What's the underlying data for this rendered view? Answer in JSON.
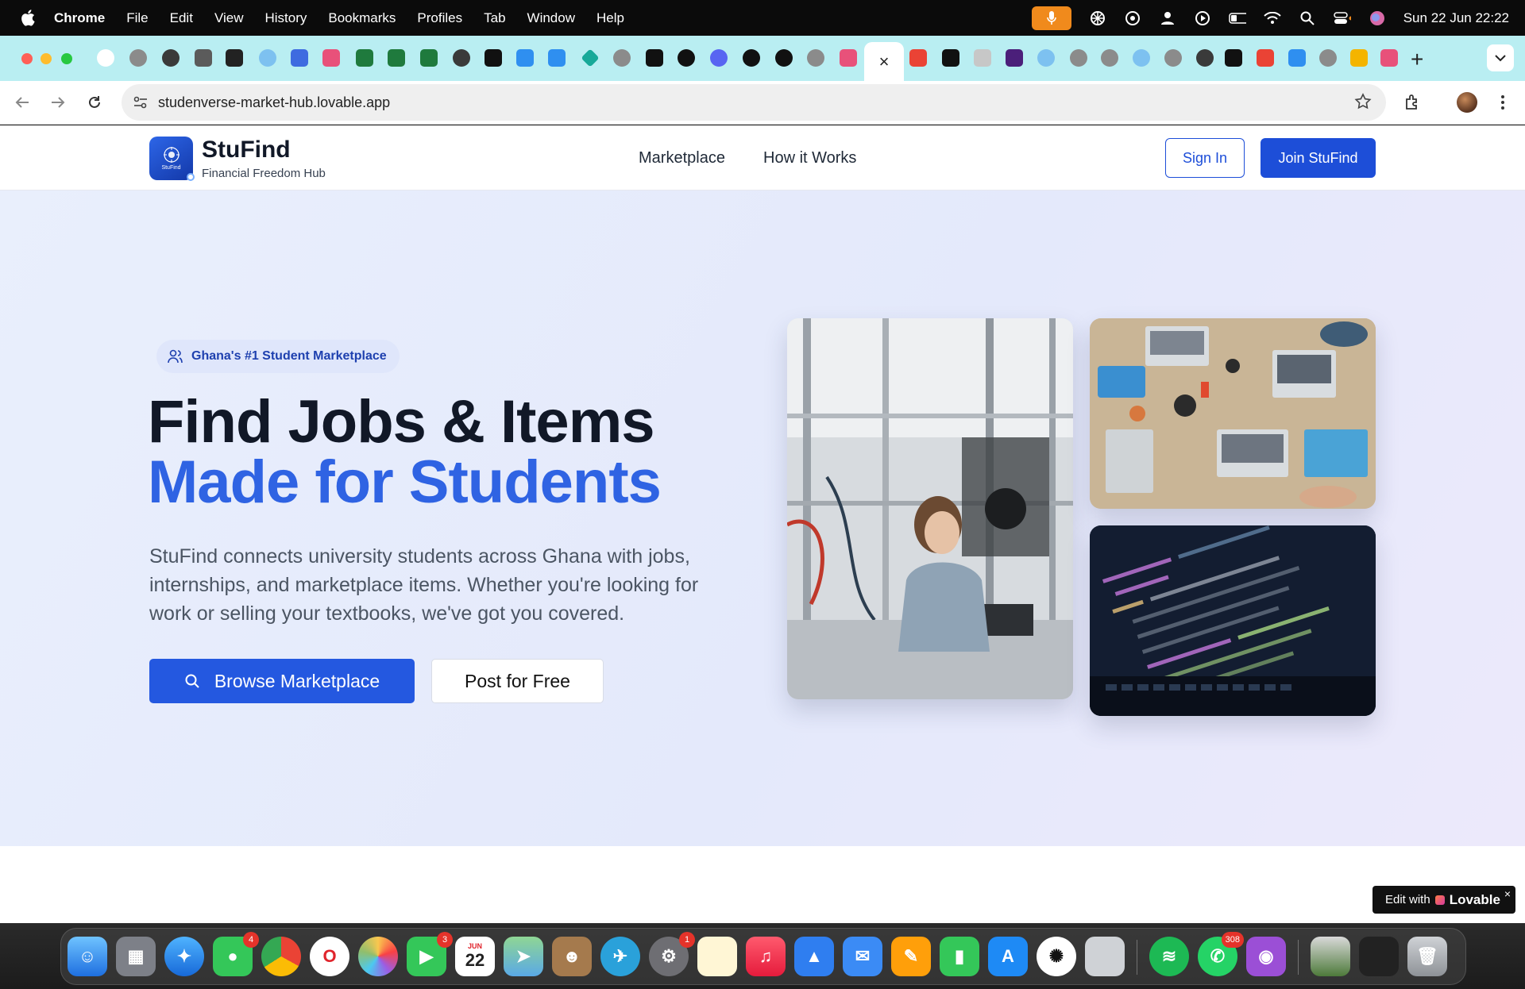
{
  "menubar": {
    "app_name": "Chrome",
    "menus": [
      "File",
      "Edit",
      "View",
      "History",
      "Bookmarks",
      "Profiles",
      "Tab",
      "Window",
      "Help"
    ],
    "clock": "Sun 22 Jun  22:22"
  },
  "browser": {
    "url": "studenverse-market-hub.lovable.app",
    "active_tab_icon": "close-icon"
  },
  "site": {
    "brand": "StuFind",
    "logo_text": "StuFind",
    "tagline": "Financial Freedom Hub",
    "nav": [
      "Marketplace",
      "How it Works"
    ],
    "sign_in": "Sign In",
    "join": "Join StuFind"
  },
  "hero": {
    "badge": "Ghana's #1 Student Marketplace",
    "headline_line1": "Find Jobs & Items",
    "headline_line2": "Made for Students",
    "lead": "StuFind connects university students across Ghana with jobs, internships, and marketplace items. Whether you're looking for work or selling your textbooks, we've got you covered.",
    "browse_button": "Browse Marketplace",
    "post_button": "Post for Free"
  },
  "lovable": {
    "prefix": "Edit with",
    "brand": "Lovable",
    "close": "×"
  },
  "dock": {
    "calendar_month": "JUN",
    "calendar_day": "22",
    "badges": {
      "messages": "4",
      "facetime": "3",
      "settings": "1",
      "whatsapp": "308"
    }
  },
  "colors": {
    "primary": "#1d4ed8",
    "headline_accent": "#2f63e3",
    "tab_strip": "#b9eef2"
  }
}
